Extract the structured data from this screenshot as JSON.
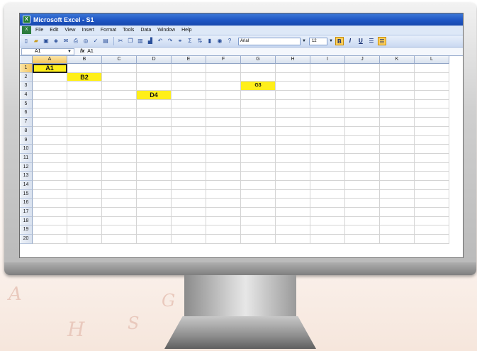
{
  "window": {
    "title": "Microsoft Excel - S1"
  },
  "menu": [
    "File",
    "Edit",
    "View",
    "Insert",
    "Format",
    "Tools",
    "Data",
    "Window",
    "Help"
  ],
  "toolbar": {
    "font_name": "Arial",
    "font_size": "12",
    "sum_symbol": "Σ",
    "bold": "B",
    "italic": "I",
    "underline": "U"
  },
  "formula_bar": {
    "name_box": "A1",
    "fx": "fx",
    "content": "A1"
  },
  "columns": [
    "A",
    "B",
    "C",
    "D",
    "E",
    "F",
    "G",
    "H",
    "I",
    "J",
    "K",
    "L"
  ],
  "rows": [
    "1",
    "2",
    "3",
    "4",
    "5",
    "6",
    "7",
    "8",
    "9",
    "10",
    "11",
    "12",
    "13",
    "14",
    "15",
    "16",
    "17",
    "18",
    "19",
    "20"
  ],
  "cells": {
    "A1": "A1",
    "B2": "B2",
    "G3": "G3",
    "D4": "D4"
  },
  "colors": {
    "highlight": "#ffef1a",
    "title_bar": "#1f56c4"
  }
}
